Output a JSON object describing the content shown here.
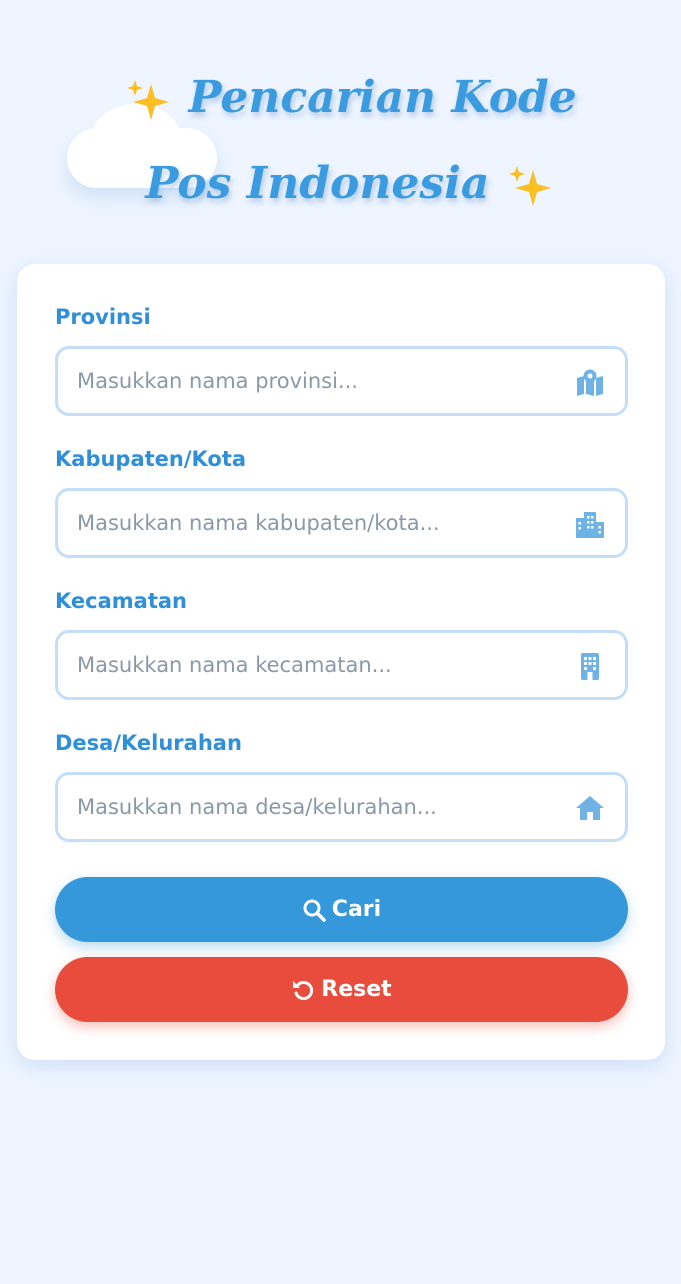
{
  "header": {
    "title": "Pencarian Kode Pos Indonesia",
    "sparkle_icon": "sparkles-icon"
  },
  "form": {
    "fields": [
      {
        "label": "Provinsi",
        "placeholder": "Masukkan nama provinsi...",
        "value": "",
        "icon": "map-location-icon"
      },
      {
        "label": "Kabupaten/Kota",
        "placeholder": "Masukkan nama kabupaten/kota...",
        "value": "",
        "icon": "city-icon"
      },
      {
        "label": "Kecamatan",
        "placeholder": "Masukkan nama kecamatan...",
        "value": "",
        "icon": "building-icon"
      },
      {
        "label": "Desa/Kelurahan",
        "placeholder": "Masukkan nama desa/kelurahan...",
        "value": "",
        "icon": "house-icon"
      }
    ],
    "search_label": "Cari",
    "reset_label": "Reset"
  },
  "colors": {
    "background": "#eef5ff",
    "accent": "#3498db",
    "danger": "#e74c3c",
    "label": "#2f8fd8",
    "icon": "#6fb3e6"
  }
}
